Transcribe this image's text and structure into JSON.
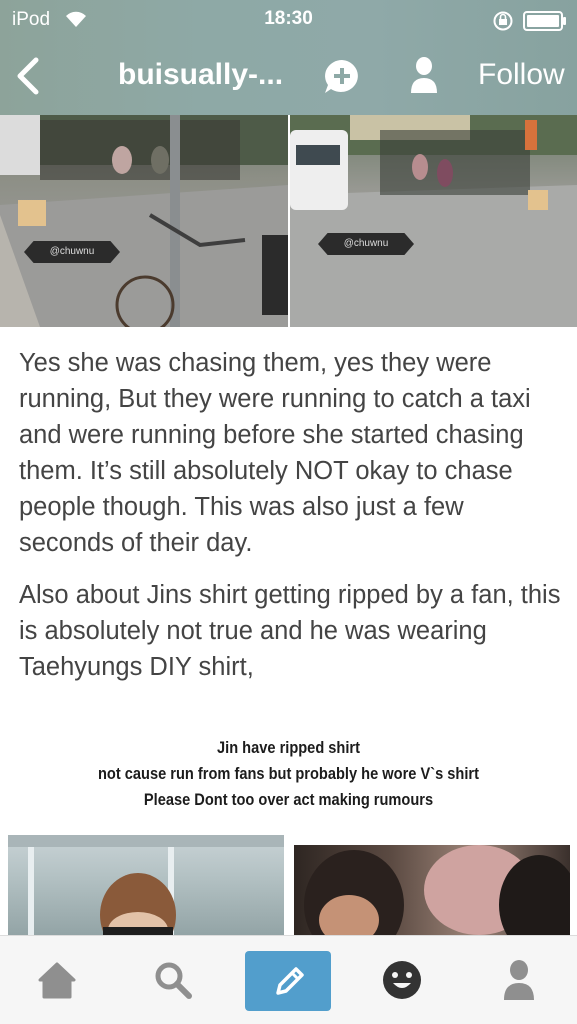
{
  "status_bar": {
    "carrier": "iPod",
    "time": "18:30"
  },
  "nav": {
    "blog_title": "buisually-...",
    "follow_label": "Follow",
    "icons": [
      "back-icon",
      "reply-icon",
      "profile-icon"
    ]
  },
  "post": {
    "photo_watermark": "@chuwnu",
    "paragraphs": [
      "Yes she was chasing them, yes they were running, But they were running to catch a taxi and were running before she started chasing them. It’s still absolutely NOT okay to chase people though. This was also just a few seconds of their day.",
      "Also about Jins shirt getting ripped by a fan, this is absolutely not true and he was wearing Taehyungs DIY shirt,"
    ],
    "image_caption": [
      "Jin have ripped shirt",
      "not cause run from fans but probably he wore V`s shirt",
      "Please Dont too over act making rumours"
    ]
  },
  "tab_bar": {
    "items": [
      "home-icon",
      "search-icon",
      "compose-icon",
      "activity-icon",
      "account-icon"
    ],
    "accent": "#529ecc"
  },
  "colors": {
    "header": "#8ea9a6",
    "text": "#444444",
    "tab_bar": "#f6f6f6"
  }
}
